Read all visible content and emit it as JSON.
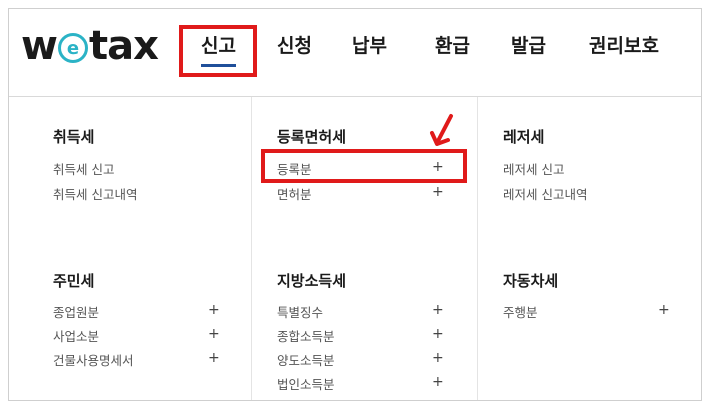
{
  "logo": {
    "prefix": "w",
    "middle": "e",
    "suffix": "tax"
  },
  "nav": {
    "items": [
      {
        "label": "신고"
      },
      {
        "label": "신청"
      },
      {
        "label": "납부"
      },
      {
        "label": "환급"
      },
      {
        "label": "발급"
      },
      {
        "label": "권리보호"
      }
    ]
  },
  "menu": {
    "sections": [
      {
        "title": "취득세",
        "links": [
          {
            "label": "취득세 신고"
          },
          {
            "label": "취득세 신고내역"
          }
        ]
      },
      {
        "title": "등록면허세",
        "links": [
          {
            "label": "등록분"
          },
          {
            "label": "면허분"
          }
        ]
      },
      {
        "title": "레저세",
        "links": [
          {
            "label": "레저세 신고"
          },
          {
            "label": "레저세 신고내역"
          }
        ]
      },
      {
        "title": "주민세",
        "links": [
          {
            "label": "종업원분"
          },
          {
            "label": "사업소분"
          },
          {
            "label": "건물사용명세서"
          }
        ]
      },
      {
        "title": "지방소득세",
        "links": [
          {
            "label": "특별징수"
          },
          {
            "label": "종합소득분"
          },
          {
            "label": "양도소득분"
          },
          {
            "label": "법인소득분"
          }
        ]
      },
      {
        "title": "자동차세",
        "links": [
          {
            "label": "주행분"
          }
        ]
      }
    ],
    "expand_symbol": "+"
  },
  "annotation_color": "#e01a1a",
  "accent_color": "#1f4f9a"
}
